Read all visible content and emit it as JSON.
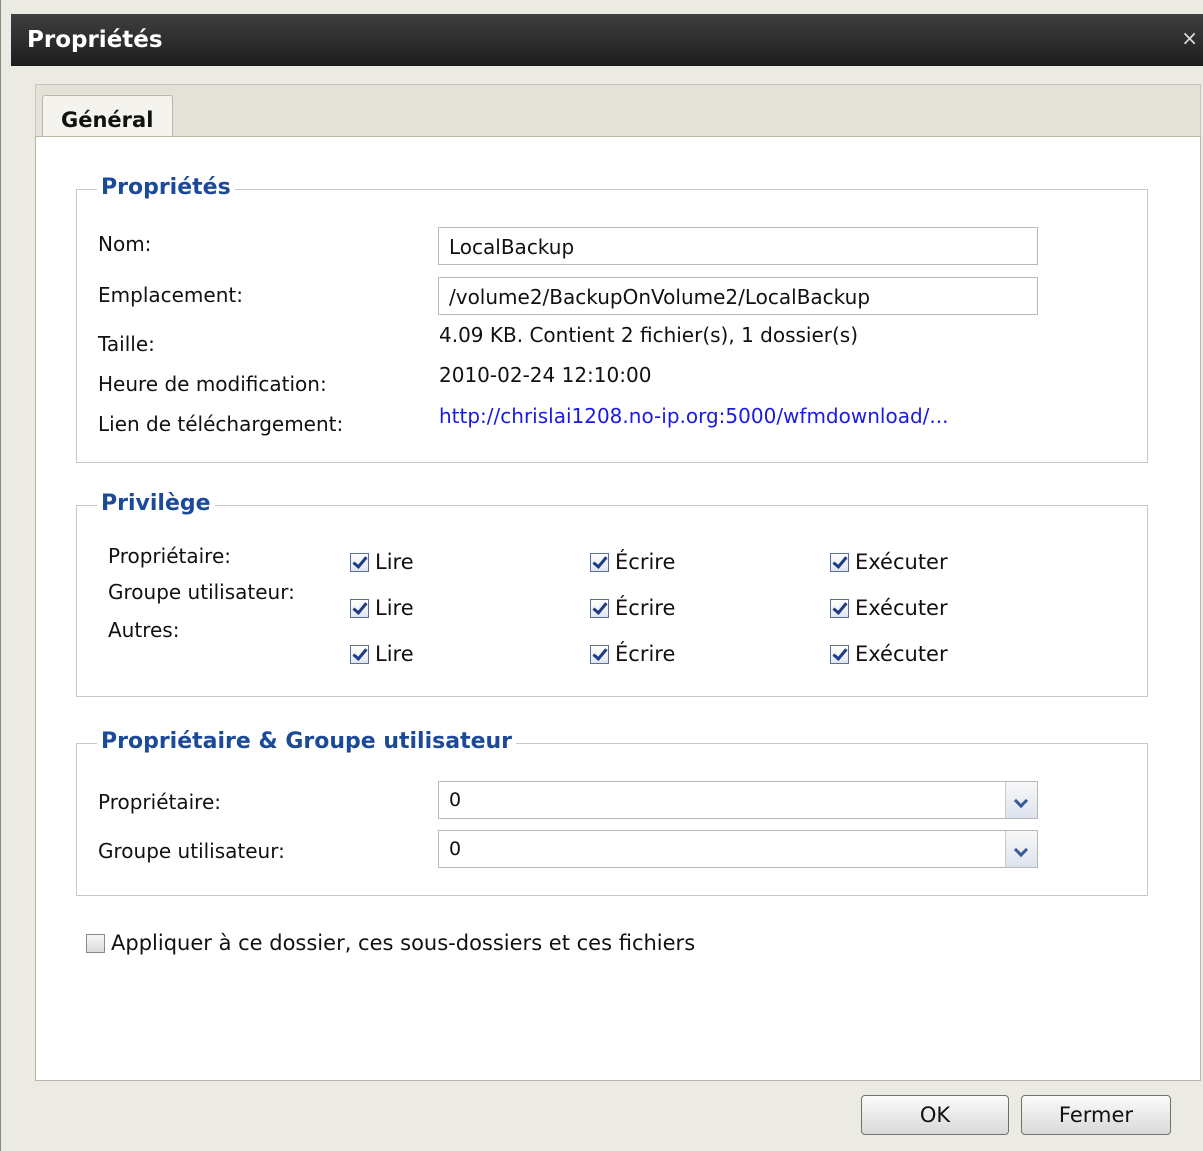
{
  "window": {
    "title": "Propriétés",
    "close_glyph": "×"
  },
  "tabs": [
    {
      "label": "Général"
    }
  ],
  "props": {
    "legend": "Propriétés",
    "name_label": "Nom:",
    "name_value": "LocalBackup",
    "location_label": "Emplacement:",
    "location_value": "/volume2/BackupOnVolume2/LocalBackup",
    "size_label": "Taille:",
    "size_value": "4.09 KB. Contient 2 fichier(s), 1 dossier(s)",
    "mtime_label": "Heure de modification:",
    "mtime_value": "2010-02-24 12:10:00",
    "link_label": "Lien de téléchargement:",
    "link_value": "http://chrislai1208.no-ip.org:5000/wfmdownload/..."
  },
  "privilege": {
    "legend": "Privilège",
    "rows": [
      {
        "label": "Propriétaire:",
        "read": "Lire",
        "write": "Écrire",
        "exec": "Exécuter",
        "read_checked": true,
        "write_checked": true,
        "exec_checked": true
      },
      {
        "label": "Groupe utilisateur:",
        "read": "Lire",
        "write": "Écrire",
        "exec": "Exécuter",
        "read_checked": true,
        "write_checked": true,
        "exec_checked": true
      },
      {
        "label": "Autres:",
        "read": "Lire",
        "write": "Écrire",
        "exec": "Exécuter",
        "read_checked": true,
        "write_checked": true,
        "exec_checked": true
      }
    ]
  },
  "ownership": {
    "legend": "Propriétaire & Groupe utilisateur",
    "owner_label": "Propriétaire:",
    "owner_value": "0",
    "group_label": "Groupe utilisateur:",
    "group_value": "0"
  },
  "apply": {
    "label": "Appliquer à ce dossier, ces sous-dossiers et ces fichiers",
    "checked": false
  },
  "buttons": {
    "ok": "OK",
    "close": "Fermer"
  }
}
